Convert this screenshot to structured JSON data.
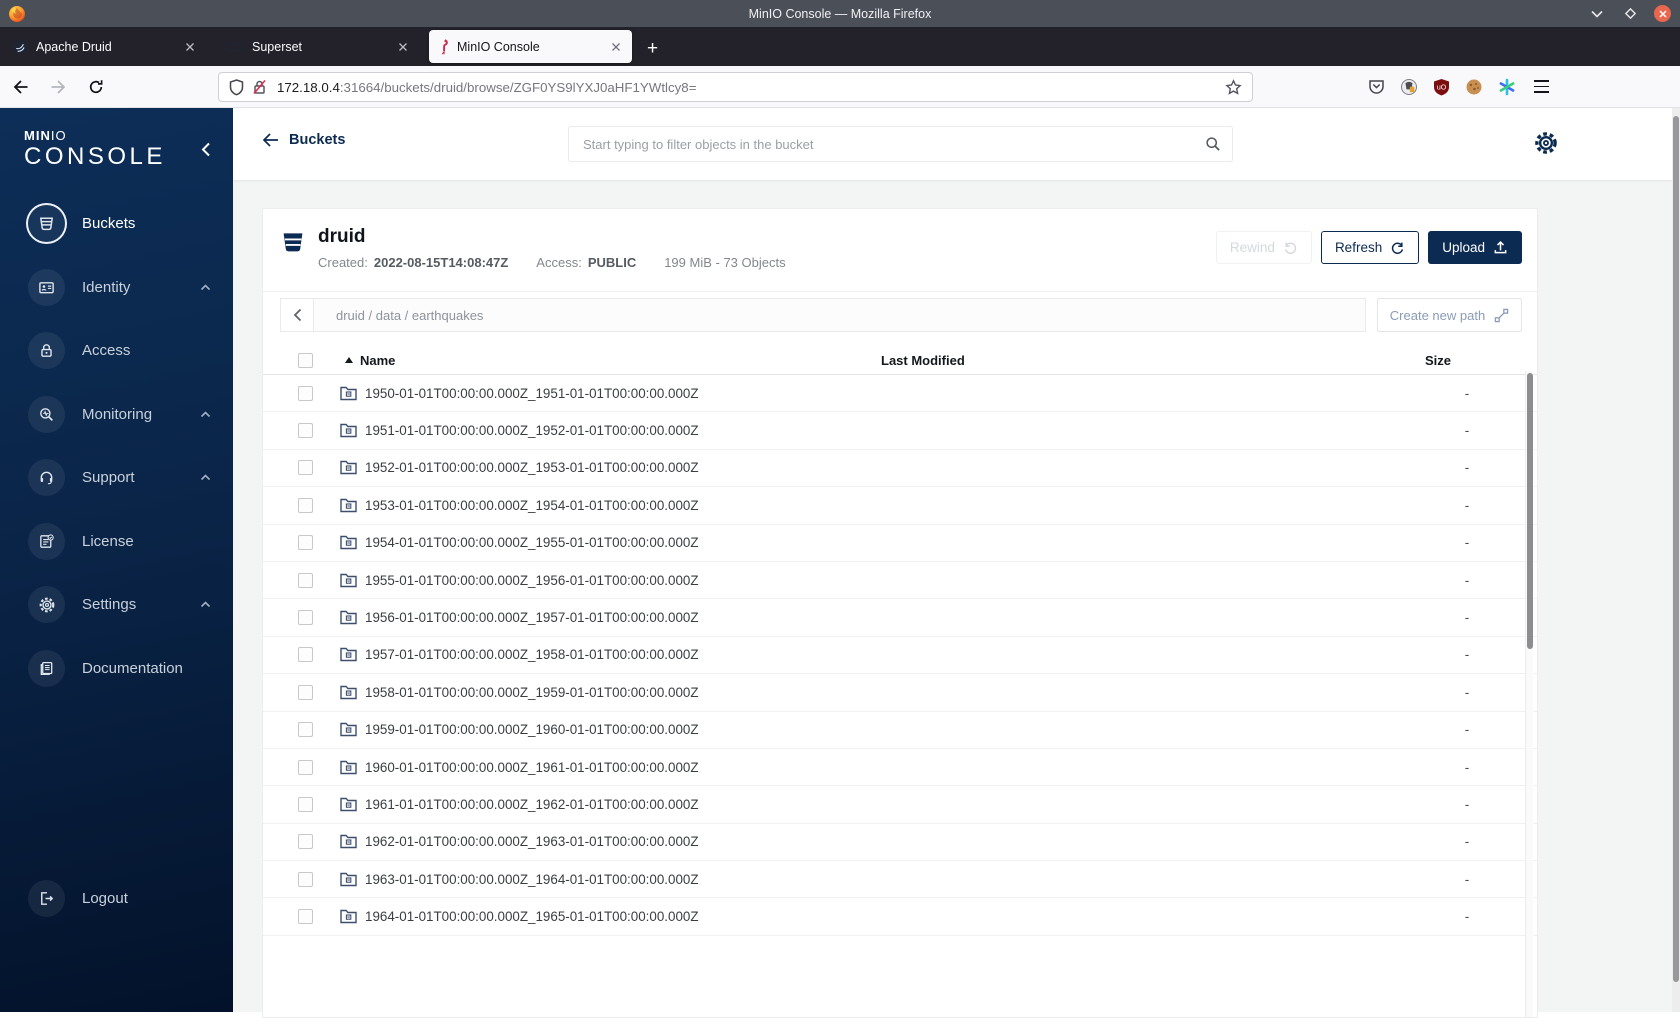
{
  "window": {
    "title": "MinIO Console — Mozilla Firefox"
  },
  "tabs": [
    {
      "label": "Apache Druid"
    },
    {
      "label": "Superset"
    },
    {
      "label": "MinIO Console"
    }
  ],
  "urlbar": {
    "host": "172.18.0.4",
    "path": ":31664/buckets/druid/browse/ZGF0YS9lYXJ0aHF1YWtlcy8="
  },
  "sidebar": {
    "logo_bold": "MIN",
    "logo_light": "IO",
    "logo_sub": "CONSOLE",
    "items": [
      {
        "label": "Buckets"
      },
      {
        "label": "Identity"
      },
      {
        "label": "Access"
      },
      {
        "label": "Monitoring"
      },
      {
        "label": "Support"
      },
      {
        "label": "License"
      },
      {
        "label": "Settings"
      },
      {
        "label": "Documentation"
      }
    ],
    "logout_label": "Logout"
  },
  "header": {
    "back_label": "Buckets",
    "search_placeholder": "Start typing to filter objects in the bucket"
  },
  "bucket": {
    "name": "druid",
    "created_label": "Created:",
    "created": "2022-08-15T14:08:47Z",
    "access_label": "Access:",
    "access": "PUBLIC",
    "usage": "199 MiB - 73 Objects",
    "rewind_label": "Rewind",
    "refresh_label": "Refresh",
    "upload_label": "Upload"
  },
  "browse": {
    "path": "druid / data / earthquakes",
    "create_label": "Create new path"
  },
  "table": {
    "headers": {
      "name": "Name",
      "modified": "Last Modified",
      "size": "Size"
    },
    "rows": [
      {
        "name": "1950-01-01T00:00:00.000Z_1951-01-01T00:00:00.000Z",
        "size": "-"
      },
      {
        "name": "1951-01-01T00:00:00.000Z_1952-01-01T00:00:00.000Z",
        "size": "-"
      },
      {
        "name": "1952-01-01T00:00:00.000Z_1953-01-01T00:00:00.000Z",
        "size": "-"
      },
      {
        "name": "1953-01-01T00:00:00.000Z_1954-01-01T00:00:00.000Z",
        "size": "-"
      },
      {
        "name": "1954-01-01T00:00:00.000Z_1955-01-01T00:00:00.000Z",
        "size": "-"
      },
      {
        "name": "1955-01-01T00:00:00.000Z_1956-01-01T00:00:00.000Z",
        "size": "-"
      },
      {
        "name": "1956-01-01T00:00:00.000Z_1957-01-01T00:00:00.000Z",
        "size": "-"
      },
      {
        "name": "1957-01-01T00:00:00.000Z_1958-01-01T00:00:00.000Z",
        "size": "-"
      },
      {
        "name": "1958-01-01T00:00:00.000Z_1959-01-01T00:00:00.000Z",
        "size": "-"
      },
      {
        "name": "1959-01-01T00:00:00.000Z_1960-01-01T00:00:00.000Z",
        "size": "-"
      },
      {
        "name": "1960-01-01T00:00:00.000Z_1961-01-01T00:00:00.000Z",
        "size": "-"
      },
      {
        "name": "1961-01-01T00:00:00.000Z_1962-01-01T00:00:00.000Z",
        "size": "-"
      },
      {
        "name": "1962-01-01T00:00:00.000Z_1963-01-01T00:00:00.000Z",
        "size": "-"
      },
      {
        "name": "1963-01-01T00:00:00.000Z_1964-01-01T00:00:00.000Z",
        "size": "-"
      },
      {
        "name": "1964-01-01T00:00:00.000Z_1965-01-01T00:00:00.000Z",
        "size": "-"
      }
    ]
  },
  "icons": {
    "tab_1": "druid-logo",
    "tab_2": "superset-logo",
    "tab_3": "minio-flamingo",
    "search": "magnifier",
    "settings": "gear",
    "upload": "upload-tray",
    "refresh": "circular-arrow",
    "rewind": "counterclockwise-arrow",
    "rows": "folder",
    "logout": "exit-door"
  },
  "colors": {
    "accent_navy": "#0c2b52",
    "flamingo_red": "#c72e49",
    "close_button": "#e9664f",
    "ublock_red": "#7e0d10",
    "titlebar": "#4b5058",
    "tabbar": "#23222b",
    "toolbar": "#f9f9fb",
    "page_bg": "#f3f4f4"
  }
}
